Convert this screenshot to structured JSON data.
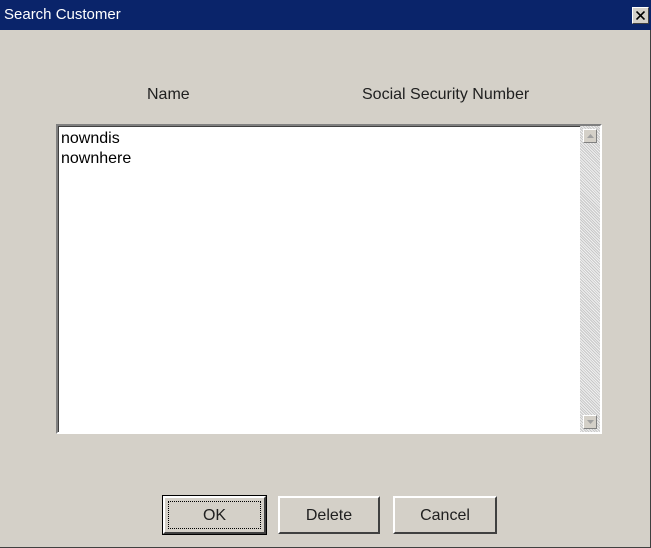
{
  "window": {
    "title": "Search Customer"
  },
  "columns": {
    "name": "Name",
    "ssn": "Social Security Number"
  },
  "list": {
    "items": [
      "nowndis",
      "nownhere"
    ]
  },
  "buttons": {
    "ok": "OK",
    "delete": "Delete",
    "cancel": "Cancel"
  },
  "icons": {
    "close": "close-icon",
    "scroll_up": "arrow-up-icon",
    "scroll_down": "arrow-down-icon"
  },
  "colors": {
    "titlebar": "#0a246a",
    "face": "#d4d0c8"
  }
}
